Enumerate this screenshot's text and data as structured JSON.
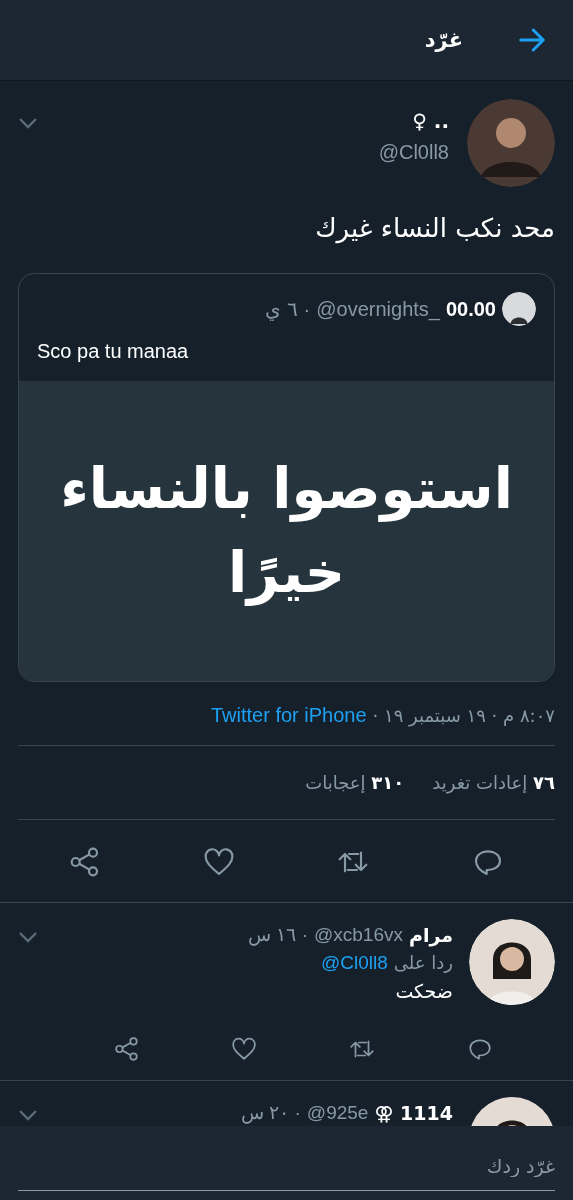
{
  "header": {
    "title": "غرّد"
  },
  "tweet": {
    "name": ".. ♀",
    "handle": "@Cl0ll8",
    "text": "محد نكب النساء غيرك",
    "quote": {
      "name": "00.00",
      "handle": "@overnights_",
      "time": "· ٦ ي",
      "text": "Sco pa tu manaa",
      "image_text": "استوصوا بالنساء خيرًا"
    },
    "meta": "٨:٠٧ م · ١٩ سبتمبر ١٩ ·",
    "source": "Twitter for iPhone",
    "stats": [
      {
        "count": "٧٦",
        "label": "إعادات تغريد"
      },
      {
        "count": "٣١٠",
        "label": "إعجابات"
      }
    ]
  },
  "replies": [
    {
      "name": "مرام",
      "handle": "@xcb16vx",
      "time": "· ١٦ س",
      "reply_to_label": "ردا على",
      "reply_to": "@Cl0ll8",
      "text": "ضحكت"
    },
    {
      "name": "1114 ⚢",
      "handle": "@925e",
      "time": "· ٢٠ س"
    }
  ],
  "composer": {
    "placeholder": "غرّد ردك"
  }
}
